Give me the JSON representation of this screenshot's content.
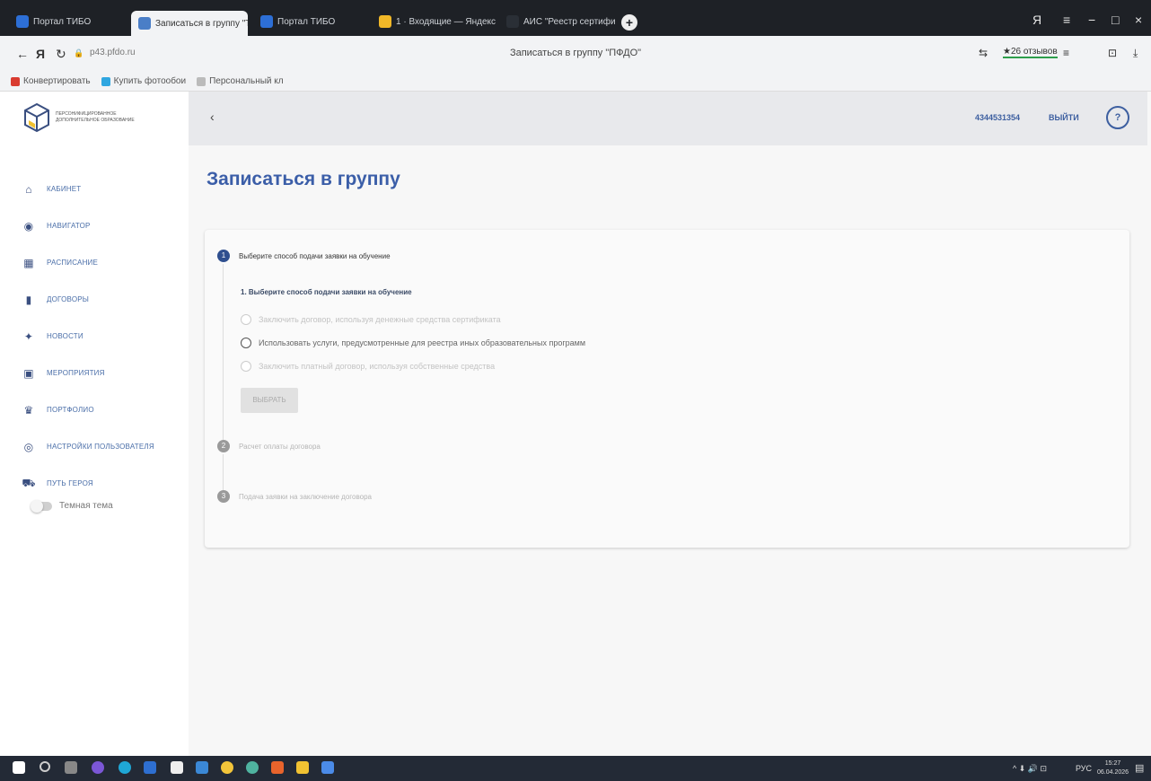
{
  "browser": {
    "tabs": [
      {
        "label": "Портал ТИБО",
        "color": "#2d6fd6"
      },
      {
        "label": "Записаться в группу \"Т",
        "color": "#4a7ec7"
      },
      {
        "label": "Портал ТИБО",
        "color": "#2d6fd6"
      },
      {
        "label": "1 · Входящие — Яндекс",
        "color": "#f1b828"
      },
      {
        "label": "АИС \"Реестр сертификат",
        "color": "#2a2f36"
      }
    ],
    "tab_close": "×",
    "new_tab": "+",
    "url": "р43.pfdo.ru",
    "page_title": "Записаться в группу \"ПФДО\"",
    "reviews": "★26 отзывов",
    "nav": {
      "back": "←",
      "yandex": "Я",
      "reload": "↻",
      "lock": "🔒"
    },
    "toolbar": {
      "translate": "⇆",
      "menu": "≡",
      "minimize": "−",
      "maximize": "□",
      "close": "×",
      "profile": "Я",
      "download": "⤓",
      "extensions": "⊡"
    },
    "bookmarks": [
      {
        "label": "Конвертировать",
        "color": "#d93b30"
      },
      {
        "label": "Купить фотообои",
        "color": "#2fa6e0"
      },
      {
        "label": "Персональный кл",
        "color": "#bbbbbb"
      }
    ]
  },
  "sidebar": {
    "logo_text": "Персонифицированное дополнительное образование",
    "items": [
      {
        "label": "Кабинет",
        "icon": "⌂"
      },
      {
        "label": "Навигатор",
        "icon": "◉"
      },
      {
        "label": "Расписание",
        "icon": "▦"
      },
      {
        "label": "Договоры",
        "icon": "▮"
      },
      {
        "label": "Новости",
        "icon": "✦"
      },
      {
        "label": "Мероприятия",
        "icon": "▣"
      },
      {
        "label": "Портфолио",
        "icon": "♛"
      },
      {
        "label": "Настройки пользователя",
        "icon": "◎"
      },
      {
        "label": "Путь героя",
        "icon": "⛟"
      }
    ],
    "theme_label": "Темная тема"
  },
  "header": {
    "back_icon": "‹",
    "user_id": "4344531354",
    "logout": "Выйти",
    "help": "?"
  },
  "page": {
    "title": "Записаться в группу",
    "steps": [
      {
        "num": "1",
        "label": "Выберите способ подачи заявки на обучение"
      },
      {
        "num": "2",
        "label": "Расчет оплаты договора"
      },
      {
        "num": "3",
        "label": "Подача заявки на заключение договора"
      }
    ],
    "section_title": "1. Выберите способ подачи заявки на обучение",
    "options": [
      {
        "label": "Заключить договор, используя денежные средства сертификата"
      },
      {
        "label": "Использовать услуги, предусмотренные для реестра иных образовательных программ"
      },
      {
        "label": "Заключить платный договор, используя собственные средства"
      }
    ],
    "select_button": "Выбрать"
  },
  "taskbar": {
    "clock_time": "15:27",
    "clock_date": "06.04.2026",
    "lang": "РУС",
    "tray": "^ ⬇ 🔊 ⊡",
    "notifications": "▤",
    "icons": [
      {
        "name": "windows-start",
        "color": "#ffffff"
      },
      {
        "name": "search",
        "color": "#cccccc"
      },
      {
        "name": "task-view",
        "color": "#cccccc"
      },
      {
        "name": "app-purple",
        "color": "#7b57d6"
      },
      {
        "name": "edge",
        "color": "#1fa7d6"
      },
      {
        "name": "app-blue",
        "color": "#2e6fd1"
      },
      {
        "name": "store",
        "color": "#eeeeee"
      },
      {
        "name": "mail",
        "color": "#3b88d6"
      },
      {
        "name": "yandex-browser",
        "color": "#f3c53a"
      },
      {
        "name": "app-teal",
        "color": "#4fb3a0"
      },
      {
        "name": "app-orange",
        "color": "#e8642c"
      },
      {
        "name": "app-yellow",
        "color": "#f1c232"
      },
      {
        "name": "app-doc",
        "color": "#4b8be8"
      }
    ]
  }
}
